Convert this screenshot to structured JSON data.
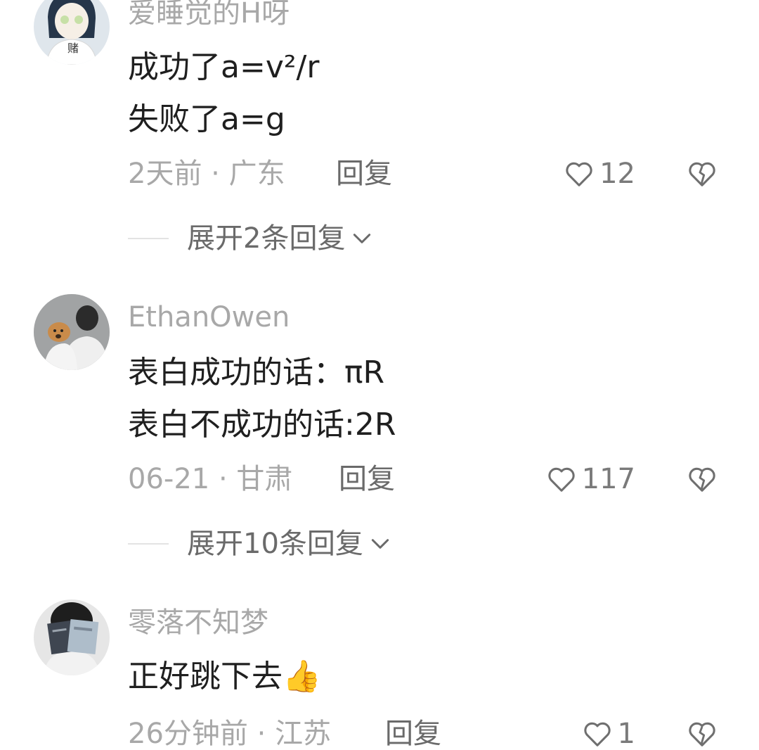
{
  "comments": [
    {
      "username": "爱睡觉的H呀",
      "lines": [
        "成功了a=v²/r",
        "失败了a=g"
      ],
      "time": "2天前",
      "separator": "·",
      "location": "广东",
      "reply_label": "回复",
      "likes": "12",
      "expand_label": "展开2条回复",
      "avatar_text": "赌"
    },
    {
      "username": "EthanOwen",
      "lines": [
        "表白成功的话：πR",
        "表白不成功的话:2R"
      ],
      "time": "06-21",
      "separator": "·",
      "location": "甘肃",
      "reply_label": "回复",
      "likes": "117",
      "expand_label": "展开10条回复"
    },
    {
      "username": "零落不知梦",
      "lines": [
        "正好跳下去"
      ],
      "emoji": "👍",
      "time": "26分钟前",
      "separator": "·",
      "location": "江苏",
      "reply_label": "回复",
      "likes": "1"
    }
  ],
  "icons": {
    "like": "heart-outline-icon",
    "dislike": "broken-heart-icon",
    "expand": "chevron-down-icon"
  },
  "colors": {
    "username": "#a8a8a8",
    "content": "#1f1f1f",
    "meta": "#a8a8a8",
    "action": "#6a6a6a"
  }
}
